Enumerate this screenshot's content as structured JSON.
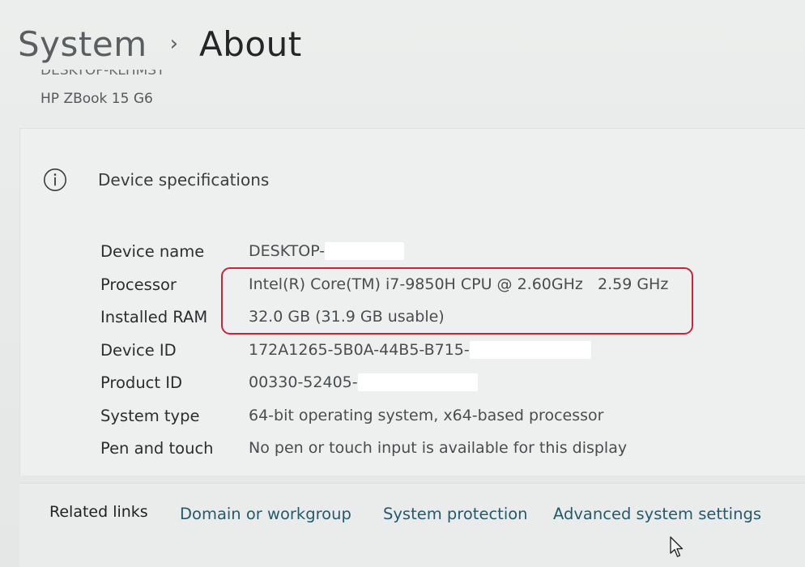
{
  "breadcrumb": {
    "parent": "System",
    "separator": "›",
    "current": "About"
  },
  "device_header": {
    "device_name_partial": "DESKTOP-KLHMST",
    "model": "HP ZBook 15 G6"
  },
  "specs": {
    "title": "Device specifications",
    "icon": "info-icon",
    "rows": [
      {
        "label": "Device name",
        "value": "DESKTOP-",
        "redacted": true
      },
      {
        "label": "Processor",
        "value": "Intel(R) Core(TM) i7-9850H CPU @ 2.60GHz   2.59 GHz",
        "redacted": false
      },
      {
        "label": "Installed RAM",
        "value": "32.0 GB (31.9 GB usable)",
        "redacted": false
      },
      {
        "label": "Device ID",
        "value": "172A1265-5B0A-44B5-B715-",
        "redacted": true
      },
      {
        "label": "Product ID",
        "value": "00330-52405-",
        "redacted": true
      },
      {
        "label": "System type",
        "value": "64-bit operating system, x64-based processor",
        "redacted": false
      },
      {
        "label": "Pen and touch",
        "value": "No pen or touch input is available for this display",
        "redacted": false
      }
    ],
    "highlight_color": "#c8253a"
  },
  "related": {
    "label": "Related links",
    "links": [
      "Domain or workgroup",
      "System protection",
      "Advanced system settings"
    ],
    "link_color": "#245a6c"
  }
}
